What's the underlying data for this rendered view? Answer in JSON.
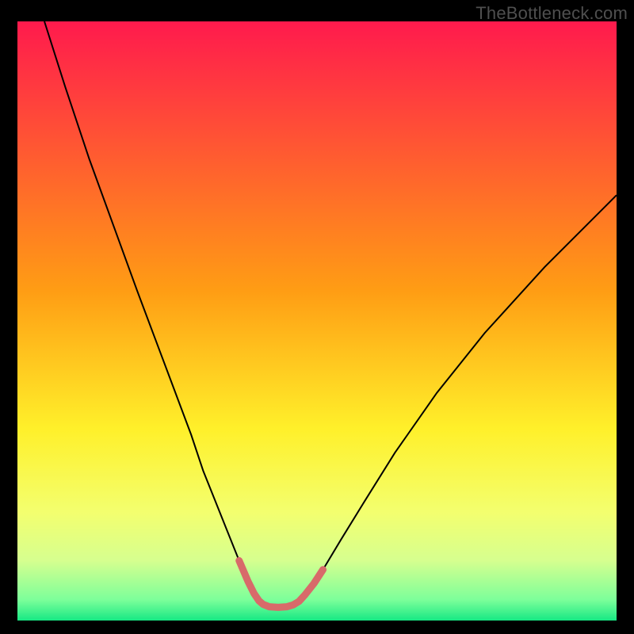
{
  "watermark": {
    "text": "TheBottleneck.com"
  },
  "chart_data": {
    "type": "line",
    "title": "",
    "xlabel": "",
    "ylabel": "",
    "xlim": [
      0,
      100
    ],
    "ylim": [
      0,
      100
    ],
    "legend": false,
    "grid": false,
    "background_gradient_stops": [
      {
        "offset": 0.0,
        "color": "#ff1a4d"
      },
      {
        "offset": 0.45,
        "color": "#ff9d14"
      },
      {
        "offset": 0.68,
        "color": "#fff02a"
      },
      {
        "offset": 0.82,
        "color": "#f3ff6f"
      },
      {
        "offset": 0.9,
        "color": "#d6ff8f"
      },
      {
        "offset": 0.965,
        "color": "#7dff9a"
      },
      {
        "offset": 1.0,
        "color": "#17e884"
      }
    ],
    "series": [
      {
        "name": "bottleneck-curve",
        "color": "#000000",
        "stroke_width": 2,
        "x": [
          4.5,
          8,
          12,
          16,
          20,
          23,
          26,
          29,
          31,
          33,
          35,
          37,
          38.5,
          39.5,
          40.3,
          41,
          42,
          45,
          46,
          47,
          48,
          49.5,
          51,
          54,
          58,
          63,
          70,
          78,
          88,
          100
        ],
        "values": [
          100,
          89,
          77,
          66,
          55,
          47,
          39,
          31,
          25,
          20,
          15,
          10,
          6.5,
          4.5,
          3.3,
          2.7,
          2.3,
          2.3,
          2.6,
          3.2,
          4.3,
          6.2,
          8.5,
          13.5,
          20,
          28,
          38,
          48,
          59,
          71
        ]
      },
      {
        "name": "highlight-valley",
        "color": "#d86a6a",
        "stroke_width": 9,
        "linecap": "round",
        "x": [
          37,
          38.5,
          39.5,
          40.3,
          41,
          42,
          43.5,
          45,
          46,
          47,
          48,
          49.5,
          51
        ],
        "values": [
          10,
          6.5,
          4.5,
          3.3,
          2.7,
          2.3,
          2.2,
          2.3,
          2.6,
          3.2,
          4.3,
          6.2,
          8.5
        ]
      }
    ]
  }
}
